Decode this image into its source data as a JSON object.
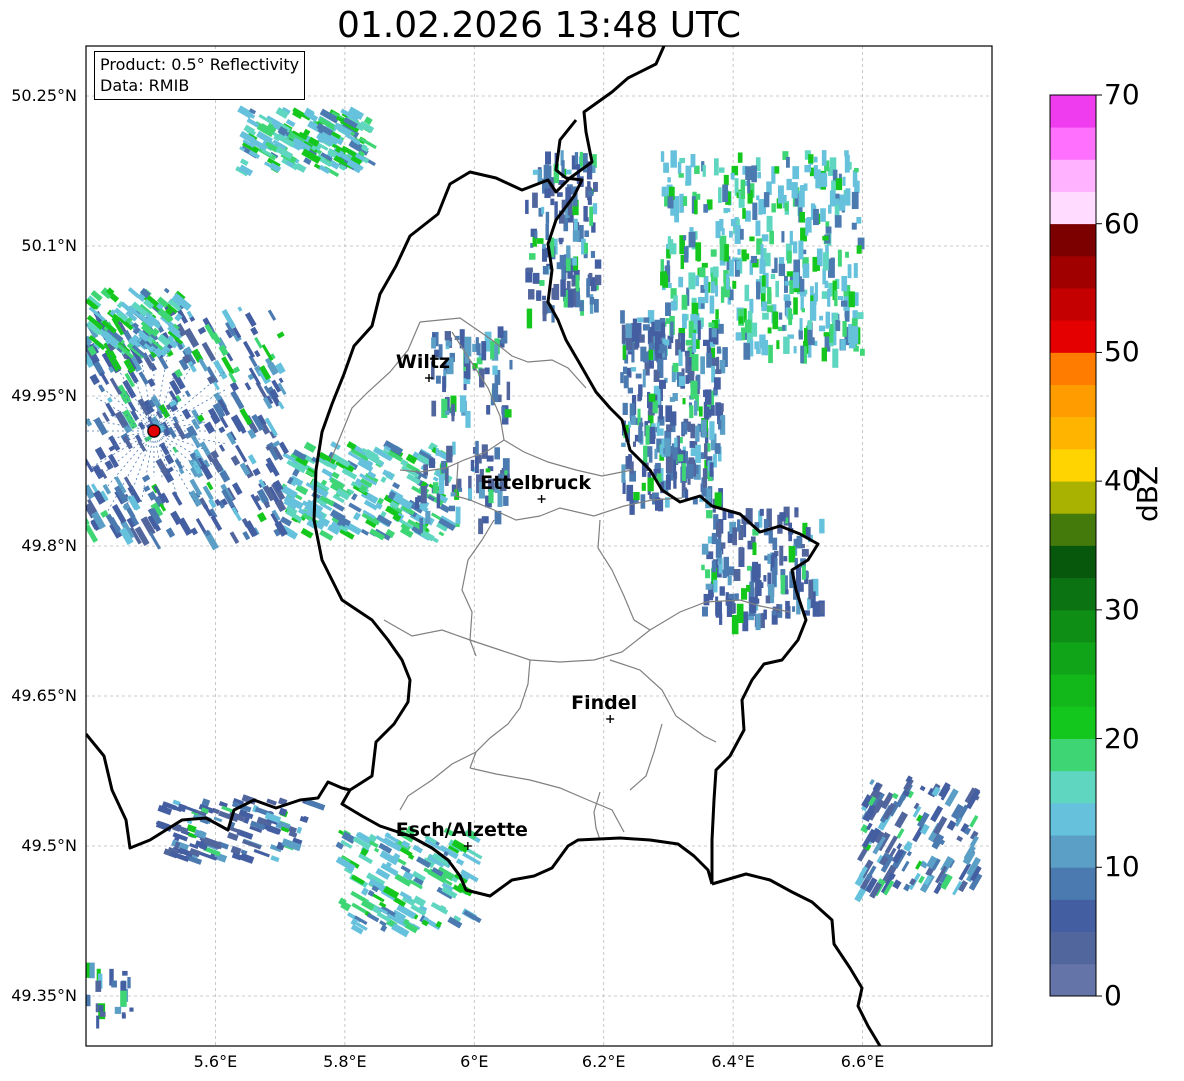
{
  "title": "01.02.2026 13:48 UTC",
  "info": {
    "product": "Product: 0.5° Reflectivity",
    "source": "Data: RMIB"
  },
  "map": {
    "lon_range": [
      5.4,
      6.8
    ],
    "lat_range": [
      49.3,
      50.3
    ],
    "x_ticks": [
      {
        "value": 5.6,
        "label": "5.6°E"
      },
      {
        "value": 5.8,
        "label": "5.8°E"
      },
      {
        "value": 6.0,
        "label": "6°E"
      },
      {
        "value": 6.2,
        "label": "6.2°E"
      },
      {
        "value": 6.4,
        "label": "6.4°E"
      },
      {
        "value": 6.6,
        "label": "6.6°E"
      }
    ],
    "y_ticks": [
      {
        "value": 50.25,
        "label": "50.25°N"
      },
      {
        "value": 50.1,
        "label": "50.1°N"
      },
      {
        "value": 49.95,
        "label": "49.95°N"
      },
      {
        "value": 49.8,
        "label": "49.8°N"
      },
      {
        "value": 49.65,
        "label": "49.65°N"
      },
      {
        "value": 49.5,
        "label": "49.5°N"
      },
      {
        "value": 49.35,
        "label": "49.35°N"
      }
    ],
    "grid": true,
    "cities": [
      {
        "name": "Wiltz",
        "lon": 5.93,
        "lat": 49.968
      },
      {
        "name": "Ettelbruck",
        "lon": 6.104,
        "lat": 49.847
      },
      {
        "name": "Findel",
        "lon": 6.21,
        "lat": 49.627
      },
      {
        "name": "Esch/Alzette",
        "lon": 5.99,
        "lat": 49.5
      }
    ],
    "radar_site": {
      "lon": 5.505,
      "lat": 49.915,
      "color": "#e00000"
    },
    "border_color": "#000000",
    "canton_color": "#808080"
  },
  "colorbar": {
    "label": "dBZ",
    "min": 0,
    "max": 70,
    "step": 2.5,
    "ticks": [
      0,
      10,
      20,
      30,
      40,
      50,
      60,
      70
    ],
    "colors": [
      "#6474a8",
      "#52669e",
      "#445ea2",
      "#4b7ab0",
      "#5b9fc6",
      "#66c1dc",
      "#5fd6c0",
      "#3ed674",
      "#14c71c",
      "#12b81a",
      "#10a418",
      "#0e8e15",
      "#0c7312",
      "#07580d",
      "#437a0b",
      "#a9b200",
      "#ffd400",
      "#ffb400",
      "#ff9c00",
      "#ff7c00",
      "#e40000",
      "#c40000",
      "#a00000",
      "#7c0000",
      "#ffdcff",
      "#ffb2ff",
      "#ff70ff",
      "#ee3cee"
    ]
  }
}
